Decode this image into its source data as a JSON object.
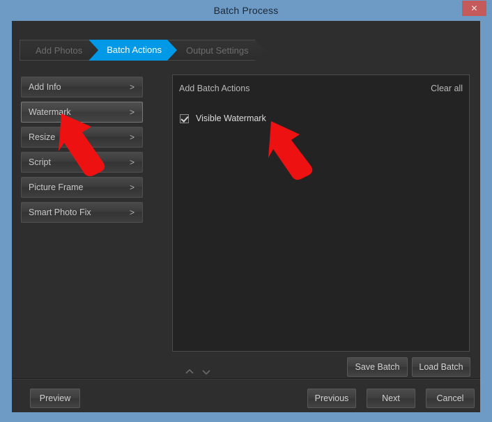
{
  "window": {
    "title": "Batch Process",
    "close_label": "✕",
    "accent_blue": "#6e9ac6",
    "close_red": "#c45a5a",
    "active_tab_blue": "#0099e8",
    "annotation_red": "#ee1111"
  },
  "breadcrumb": {
    "steps": [
      {
        "label": "Add Photos",
        "state": "inactive"
      },
      {
        "label": "Batch Actions",
        "state": "active"
      },
      {
        "label": "Output Settings",
        "state": "inactive"
      }
    ]
  },
  "sidebar": {
    "items": [
      {
        "label": "Add Info",
        "chevron": ">",
        "selected": false
      },
      {
        "label": "Watermark",
        "chevron": ">",
        "selected": true
      },
      {
        "label": "Resize",
        "chevron": ">",
        "selected": false
      },
      {
        "label": "Script",
        "chevron": ">",
        "selected": false
      },
      {
        "label": "Picture Frame",
        "chevron": ">",
        "selected": false
      },
      {
        "label": "Smart Photo Fix",
        "chevron": ">",
        "selected": false
      }
    ]
  },
  "panel": {
    "title": "Add Batch Actions",
    "clear_all": "Clear all",
    "actions": [
      {
        "label": "Visible Watermark",
        "checked": true
      }
    ],
    "reorder": {
      "move_up": "move-up",
      "move_down": "move-down"
    },
    "save_batch": "Save Batch",
    "load_batch": "Load Batch"
  },
  "footer": {
    "preview": "Preview",
    "previous": "Previous",
    "next": "Next",
    "cancel": "Cancel"
  },
  "annotations": [
    {
      "name": "arrow-to-watermark",
      "points_to": "Watermark"
    },
    {
      "name": "arrow-to-visible-watermark",
      "points_to": "Visible Watermark"
    }
  ]
}
